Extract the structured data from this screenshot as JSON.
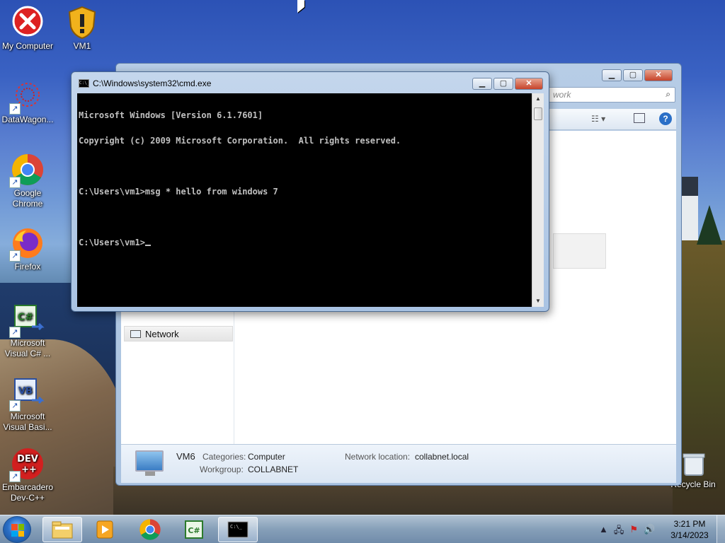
{
  "desktop": {
    "icons": [
      {
        "id": "my-computer",
        "label": "My Computer"
      },
      {
        "id": "vm1",
        "label": "VM1"
      },
      {
        "id": "datawagon",
        "label": "DataWagon..."
      },
      {
        "id": "chrome",
        "label": "Google Chrome"
      },
      {
        "id": "firefox",
        "label": "Firefox"
      },
      {
        "id": "vcsharp",
        "label": "Microsoft Visual C# ..."
      },
      {
        "id": "vbasic",
        "label": "Microsoft Visual Basi..."
      },
      {
        "id": "devcpp",
        "label": "Embarcadero Dev-C++"
      },
      {
        "id": "recycle",
        "label": "Recycle Bin"
      }
    ]
  },
  "explorer": {
    "search_placeholder": "work",
    "nav_network": "Network",
    "details": {
      "name": "VM6",
      "categories_label": "Categories:",
      "categories_value": "Computer",
      "workgroup_label": "Workgroup:",
      "workgroup_value": "COLLABNET",
      "netloc_label": "Network location:",
      "netloc_value": "collabnet.local"
    }
  },
  "cmd": {
    "title": "C:\\Windows\\system32\\cmd.exe",
    "lines": [
      "Microsoft Windows [Version 6.1.7601]",
      "Copyright (c) 2009 Microsoft Corporation.  All rights reserved.",
      "",
      "C:\\Users\\vm1>msg * hello from windows 7",
      "",
      "C:\\Users\\vm1>"
    ]
  },
  "taskbar": {
    "time": "3:21 PM",
    "date": "3/14/2023"
  },
  "colors": {
    "accent": "#2a6fc7",
    "console_bg": "#000000",
    "console_fg": "#c0c0c0"
  }
}
